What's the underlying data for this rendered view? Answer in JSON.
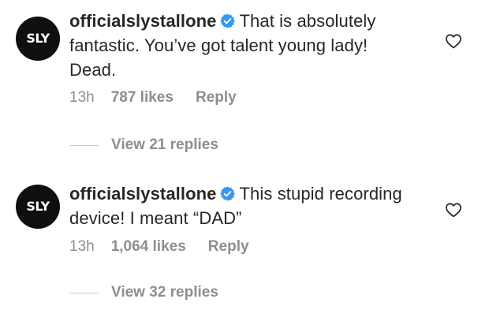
{
  "comments": [
    {
      "avatar_text": "SLY",
      "username": "officialslystallone",
      "text_line1": "That is absolutely",
      "text_rest": "fantastic. You’ve got talent young lady! Dead.",
      "time": "13h",
      "likes": "787 likes",
      "reply_label": "Reply",
      "view_replies": "View 21 replies",
      "verified_icon": "verified-badge-icon",
      "like_icon": "heart-outline-icon"
    },
    {
      "avatar_text": "SLY",
      "username": "officialslystallone",
      "text_line1": "This stupid",
      "text_rest": "recording device! I meant “DAD”",
      "time": "13h",
      "likes": "1,064 likes",
      "reply_label": "Reply",
      "view_replies": "View 32 replies",
      "verified_icon": "verified-badge-icon",
      "like_icon": "heart-outline-icon"
    }
  ],
  "colors": {
    "text_primary": "#262626",
    "text_secondary": "#8e8e8e",
    "verified_blue": "#3897f0",
    "avatar_bg": "#0f0f0f"
  }
}
